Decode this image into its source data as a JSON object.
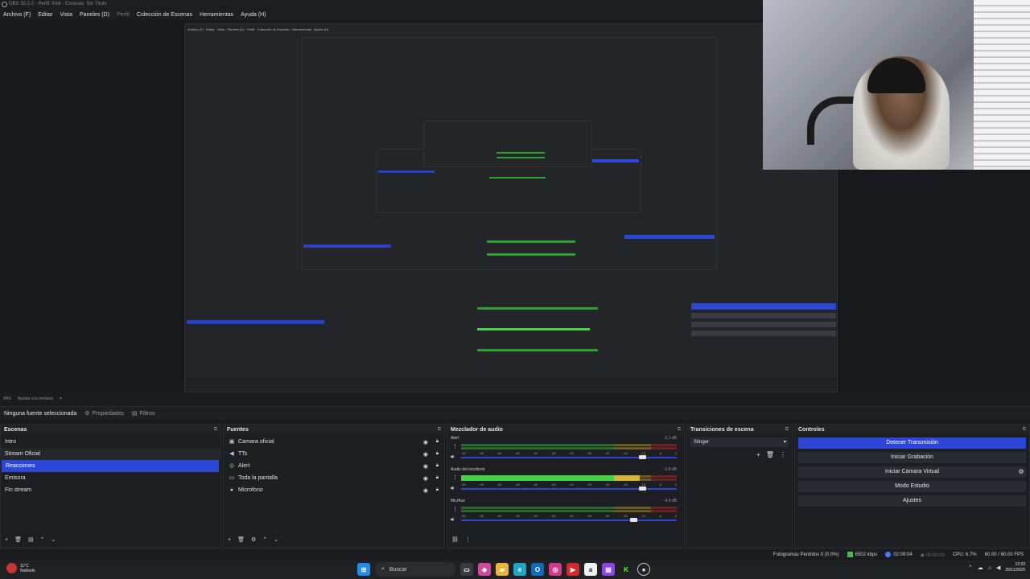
{
  "titlebar": {
    "text": "OBS 32.0.2 - Perfil: Kick - Escenas: Sin Título"
  },
  "menu": {
    "items": [
      {
        "label": "Archivo (F)"
      },
      {
        "label": "Editar"
      },
      {
        "label": "Vista"
      },
      {
        "label": "Paneles (D)"
      },
      {
        "label": "Perfil"
      },
      {
        "label": "Colección de Escenas"
      },
      {
        "label": "Herramientas"
      },
      {
        "label": "Ayuda (H)"
      }
    ]
  },
  "preview": {
    "zoom": "84%",
    "zoom_action": "Ajustar a la ventana"
  },
  "source_toolbar": {
    "no_selection": "Ninguna fuente seleccionada",
    "properties": "Propiedades",
    "filters": "Filtros"
  },
  "scenes": {
    "title": "Escenas",
    "items": [
      {
        "label": "Intro"
      },
      {
        "label": "Stream Oficial"
      },
      {
        "label": "Reacciones"
      },
      {
        "label": "Emisora"
      },
      {
        "label": "Fin stream"
      }
    ]
  },
  "sources": {
    "title": "Fuentes",
    "items": [
      {
        "label": "Camara oficial",
        "icon": "camera-icon"
      },
      {
        "label": "TTs",
        "icon": "speaker-icon"
      },
      {
        "label": "Alert",
        "icon": "globe-icon"
      },
      {
        "label": "Toda la pantalla",
        "icon": "monitor-icon"
      },
      {
        "label": "Microfono",
        "icon": "microphone-icon"
      }
    ]
  },
  "mixer": {
    "title": "Mezclador de audio",
    "channels": [
      {
        "name": "Alert",
        "db": "-3.1 dB",
        "level": 0,
        "fader": 0.84
      },
      {
        "name": "Audio del escritorio",
        "db": "-2.8 dB",
        "level": 0.83,
        "fader": 0.84
      },
      {
        "name": "Mic/Aux",
        "db": "-4.0 dB",
        "level": 0,
        "fader": 0.8
      }
    ],
    "ticks": [
      "-60",
      "-55",
      "-50",
      "-45",
      "-40",
      "-35",
      "-30",
      "-25",
      "-20",
      "-15",
      "-10",
      "-5",
      "0"
    ]
  },
  "transitions": {
    "title": "Transiciones de escena",
    "selected": "Stinger"
  },
  "controls": {
    "title": "Controles",
    "buttons": [
      {
        "label": "Detener Transmisión"
      },
      {
        "label": "Iniciar Grabación"
      },
      {
        "label": "Iniciar Cámara Virtual"
      },
      {
        "label": "Modo Estudio"
      },
      {
        "label": "Ajustes"
      }
    ]
  },
  "status": {
    "dropped": "Fotogramas Perdidos 0 (0.0%)",
    "bitrate": "6502 kbps",
    "stream_time": "02:09:04",
    "rec_time": "00:00:00",
    "cpu": "CPU: 6.7%",
    "fps": "60.00 / 60.00 FPS",
    "bitrate_color": "#3cc43c",
    "live_color": "#4a7cff"
  },
  "taskbar": {
    "temp": "11°C",
    "condition": "Nublado",
    "search": "Buscar",
    "time": "12:33",
    "date": "25/11/2025"
  },
  "colors": {
    "accent": "#2c47d6",
    "meter_green": "#47d147",
    "meter_yellow": "#d6b23a",
    "meter_red": "#c63a3a"
  }
}
